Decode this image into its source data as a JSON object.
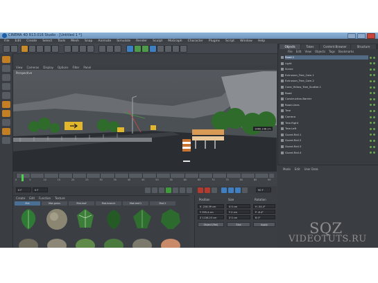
{
  "window": {
    "title": "CINEMA 4D R13.016 Studio - [Untitled 1 *]"
  },
  "menubar": [
    "File",
    "Edit",
    "Create",
    "Select",
    "Tools",
    "Mesh",
    "Snap",
    "Animate",
    "Simulate",
    "Render",
    "Sculpt",
    "MoGraph",
    "Character",
    "Plugins",
    "Script",
    "Window",
    "Help"
  ],
  "viewport": {
    "menu": [
      "View",
      "Cameras",
      "Display",
      "Options",
      "Filter",
      "Panel"
    ],
    "label": "Perspective",
    "tooltip": "1960.148 cm"
  },
  "timeline": {
    "ticks": [
      "0",
      "5",
      "10",
      "15",
      "20",
      "25",
      "30",
      "35",
      "40",
      "45",
      "50",
      "55",
      "60",
      "65",
      "70",
      "75",
      "80",
      "85",
      "90"
    ],
    "current_frame": "0 F",
    "start_field": "0 F",
    "end_field": "90 F"
  },
  "materials": {
    "menu": [
      "Create",
      "Edit",
      "Function",
      "Texture"
    ],
    "labels": [
      "Mat",
      "Mat.grass",
      "Mat.leaf",
      "Mat.branch",
      "Mat.leaf.1",
      "Mat.2"
    ],
    "selected_index": 0
  },
  "coordinates": {
    "headers": [
      "Position",
      "Size",
      "Rotation"
    ],
    "rows": [
      {
        "pos": "X  -228.39 cm",
        "size": "X  0 cm",
        "rot": "H  -54.4°"
      },
      {
        "pos": "Y  395.4 cm",
        "size": "Y  0 cm",
        "rot": "P  -8.4°"
      },
      {
        "pos": "Z  1158.23 cm",
        "size": "Z  0 cm",
        "rot": "B  0°"
      }
    ],
    "mode": "Object (Rel)",
    "size_mode": "Size",
    "apply": "Apply"
  },
  "objects": {
    "tabs": [
      "Objects",
      "Takes",
      "Content Browser",
      "Structure"
    ],
    "menu": [
      "File",
      "Edit",
      "View",
      "Objects",
      "Tags",
      "Bookmarks"
    ],
    "items": [
      {
        "name": "Road.1",
        "selected": true
      },
      {
        "name": "Light",
        "selected": false
      },
      {
        "name": "Scene",
        "selected": false
      },
      {
        "name": "Extrusion_Tree_Cam.1",
        "selected": false
      },
      {
        "name": "Extrusion_Tree_Cam.2",
        "selected": false
      },
      {
        "name": "Cone_Yellow_Tree_Scatter.1",
        "selected": false
      },
      {
        "name": "Road",
        "selected": false
      },
      {
        "name": "Construction.Barrier",
        "selected": false
      },
      {
        "name": "Road.Lines",
        "selected": false
      },
      {
        "name": "Tree",
        "selected": false
      },
      {
        "name": "Camera",
        "selected": false
      },
      {
        "name": "Tree.Right",
        "selected": false
      },
      {
        "name": "Tree.Left",
        "selected": false
      },
      {
        "name": "Guard.Rail.1",
        "selected": false
      },
      {
        "name": "Guard.Rail.2",
        "selected": false
      },
      {
        "name": "Guard.Rail.3",
        "selected": false
      },
      {
        "name": "Guard.Rail.4",
        "selected": false
      }
    ]
  },
  "attributes": {
    "menu": [
      "Mode",
      "Edit",
      "User Data"
    ]
  },
  "watermark": {
    "line1": "SQZ",
    "line2": "VIDEOTUTS.RU"
  },
  "colors": {
    "app_bg": "#3d4146",
    "selection": "#546b86",
    "accent_orange": "#c98a2a",
    "accent_blue": "#3d7fc1",
    "playhead_green": "#4cd24c"
  }
}
